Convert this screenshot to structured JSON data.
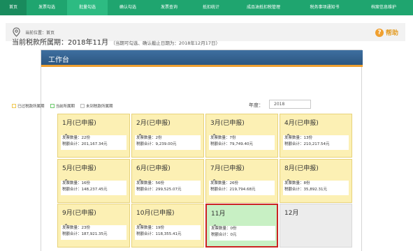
{
  "nav": {
    "items": [
      "首页",
      "发票勾选",
      "批量勾选",
      "确认勾选",
      "发票查询",
      "抵扣统计",
      "成品油抵扣税管理",
      "税务事项通知书",
      "档案信息维护"
    ]
  },
  "breadcrumb": {
    "text": "当前位置：首页"
  },
  "help": {
    "icon": "?",
    "label": "帮助"
  },
  "panel": {
    "title": "工作台"
  },
  "period": {
    "main": "当前税款所属期：2018年11月",
    "sub": "（当期可勾选、确认截止日期为：2018年12月17日）"
  },
  "legend": [
    {
      "label": "已过税款所属期",
      "color": "#f0c850"
    },
    {
      "label": "当前所属期",
      "color": "#6cc86c"
    },
    {
      "label": "未到税款所属期",
      "color": "#bbbbbb"
    }
  ],
  "year": {
    "label": "年度：",
    "value": "2018"
  },
  "months": [
    {
      "title": "1月(已申报)",
      "count": "发票数量：22份",
      "total": "税额合计：201,167.34元",
      "state": "past"
    },
    {
      "title": "2月(已申报)",
      "count": "发票数量：2份",
      "total": "税额合计：9,239.00元",
      "state": "past"
    },
    {
      "title": "3月(已申报)",
      "count": "发票数量：7份",
      "total": "税额合计：79,749.40元",
      "state": "past"
    },
    {
      "title": "4月(已申报)",
      "count": "发票数量：13份",
      "total": "税额合计：210,217.54元",
      "state": "past"
    },
    {
      "title": "5月(已申报)",
      "count": "发票数量：16份",
      "total": "税额合计：148,237.45元",
      "state": "past"
    },
    {
      "title": "6月(已申报)",
      "count": "发票数量：56份",
      "total": "税额合计：299,525.07元",
      "state": "past"
    },
    {
      "title": "7月(已申报)",
      "count": "发票数量：26份",
      "total": "税额合计：219,794.68元",
      "state": "past"
    },
    {
      "title": "8月(已申报)",
      "count": "发票数量：8份",
      "total": "税额合计：35,892.31元",
      "state": "past"
    },
    {
      "title": "9月(已申报)",
      "count": "发票数量：23份",
      "total": "税额合计：187,921.35元",
      "state": "past"
    },
    {
      "title": "10月(已申报)",
      "count": "发票数量：19份",
      "total": "税额合计：118,355.41元",
      "state": "past"
    },
    {
      "title": "11月",
      "count": "发票数量：0份",
      "total": "税额合计：0元",
      "state": "current"
    },
    {
      "title": "12月",
      "count": "",
      "total": "",
      "state": "future"
    }
  ]
}
